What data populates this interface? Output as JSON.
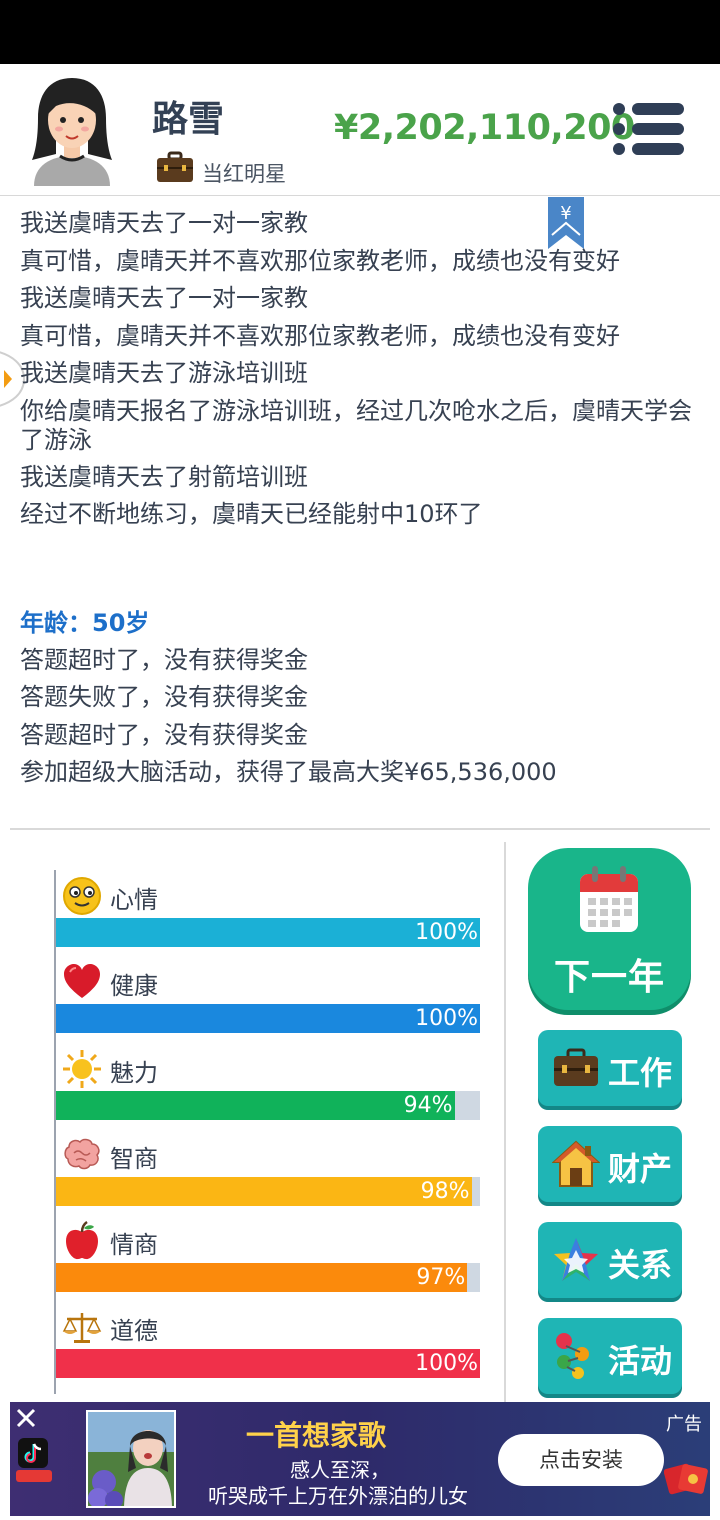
{
  "header": {
    "player_name": "路雪",
    "job": "当红明星",
    "money": "¥2,202,110,200"
  },
  "log": {
    "entries_top": [
      "我送虞晴天去了一对一家教",
      "真可惜，虞晴天并不喜欢那位家教老师，成绩也没有变好",
      "我送虞晴天去了一对一家教",
      "真可惜，虞晴天并不喜欢那位家教老师，成绩也没有变好",
      "我送虞晴天去了游泳培训班",
      "你给虞晴天报名了游泳培训班，经过几次呛水之后，虞晴天学会了游泳",
      "我送虞晴天去了射箭培训班",
      "经过不断地练习，虞晴天已经能射中10环了"
    ],
    "age": "年龄：50岁",
    "entries_bottom": [
      "答题超时了，没有获得奖金",
      "答题失败了，没有获得奖金",
      "答题超时了，没有获得奖金",
      "参加超级大脑活动，获得了最高大奖¥65,536,000"
    ]
  },
  "stats": [
    {
      "label": "心情",
      "percent_text": "100%",
      "value": 100,
      "color": "#1bb0d6",
      "icon": "smiley-icon"
    },
    {
      "label": "健康",
      "percent_text": "100%",
      "value": 100,
      "color": "#1a88de",
      "icon": "heart-icon"
    },
    {
      "label": "魅力",
      "percent_text": "94%",
      "value": 94,
      "color": "#10b25a",
      "icon": "sun-icon"
    },
    {
      "label": "智商",
      "percent_text": "98%",
      "value": 98,
      "color": "#fbb614",
      "icon": "brain-icon"
    },
    {
      "label": "情商",
      "percent_text": "97%",
      "value": 97,
      "color": "#fb8a0c",
      "icon": "apple-icon"
    },
    {
      "label": "道德",
      "percent_text": "100%",
      "value": 100,
      "color": "#f0304a",
      "icon": "scales-icon"
    }
  ],
  "actions": {
    "next_year": "下一年",
    "work": "工作",
    "property": "财产",
    "relations": "关系",
    "activities": "活动"
  },
  "ad": {
    "label": "广告",
    "title": "一首想家歌",
    "line1": "感人至深，",
    "line2": "听哭成千上万在外漂泊的儿女",
    "install": "点击安装"
  },
  "colors": {
    "money": "#4aa34a",
    "age": "#1d6fc9",
    "next_year_button": "#19b58a",
    "action_button": "#1fb5b5"
  }
}
